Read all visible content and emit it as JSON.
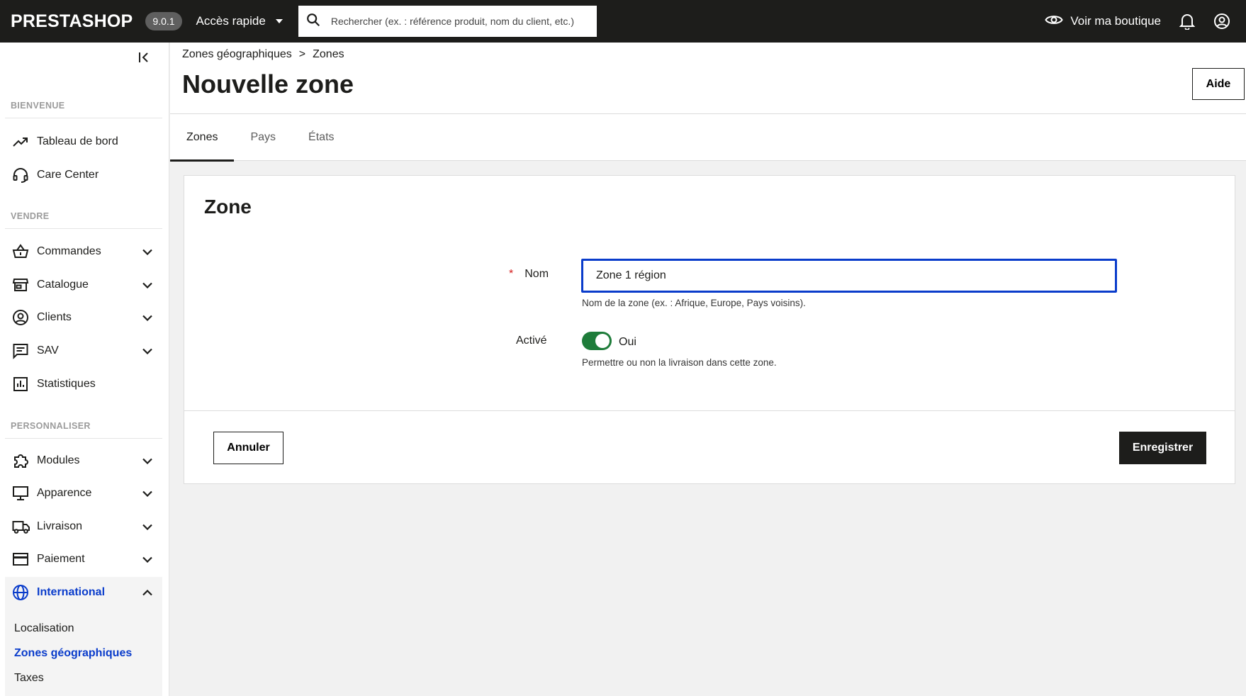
{
  "topbar": {
    "logo": "PRESTASHOP",
    "version": "9.0.1",
    "quick_access": "Accès rapide",
    "search_placeholder": "Rechercher (ex. : référence produit, nom du client, etc.)",
    "view_shop": "Voir ma boutique"
  },
  "sidebar": {
    "sections": [
      {
        "title": "BIENVENUE",
        "items": [
          {
            "label": "Tableau de bord",
            "icon": "trending-up-icon"
          },
          {
            "label": "Care Center",
            "icon": "headset-icon"
          }
        ]
      },
      {
        "title": "VENDRE",
        "items": [
          {
            "label": "Commandes",
            "icon": "basket-icon"
          },
          {
            "label": "Catalogue",
            "icon": "store-icon"
          },
          {
            "label": "Clients",
            "icon": "user-circle-icon"
          },
          {
            "label": "SAV",
            "icon": "chat-icon"
          },
          {
            "label": "Statistiques",
            "icon": "bar-chart-icon"
          }
        ]
      },
      {
        "title": "PERSONNALISER",
        "items": [
          {
            "label": "Modules",
            "icon": "puzzle-icon"
          },
          {
            "label": "Apparence",
            "icon": "monitor-icon"
          },
          {
            "label": "Livraison",
            "icon": "truck-icon"
          },
          {
            "label": "Paiement",
            "icon": "credit-card-icon"
          },
          {
            "label": "International",
            "icon": "globe-icon"
          }
        ]
      }
    ],
    "submenu": [
      "Localisation",
      "Zones géographiques",
      "Taxes"
    ],
    "active_color": "#0a3ccb"
  },
  "header": {
    "breadcrumb": [
      "Zones géographiques",
      "Zones"
    ],
    "breadcrumb_sep": ">",
    "title": "Nouvelle zone",
    "help_label": "Aide"
  },
  "tabs": [
    "Zones",
    "Pays",
    "États"
  ],
  "form": {
    "card_title": "Zone",
    "name_label": "Nom",
    "required_mark": "*",
    "name_value": "Zone 1 région",
    "name_help": "Nom de la zone (ex. : Afrique, Europe, Pays voisins).",
    "active_label": "Activé",
    "active_value": "Oui",
    "active_on": true,
    "active_help": "Permettre ou non la livraison dans cette zone.",
    "cancel_label": "Annuler",
    "save_label": "Enregistrer"
  }
}
